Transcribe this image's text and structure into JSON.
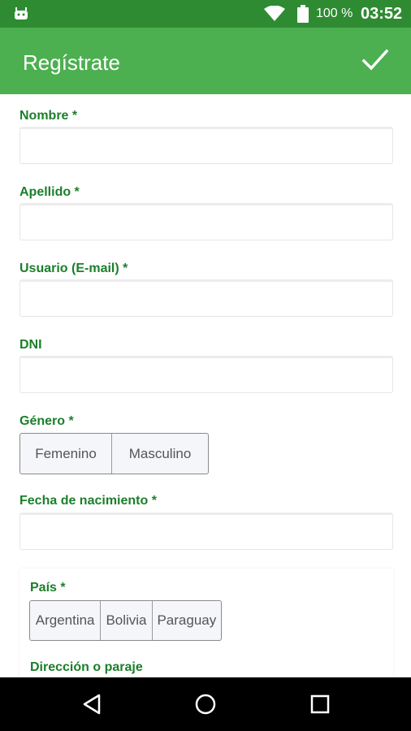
{
  "status_bar": {
    "battery_percent": "100 %",
    "time": "03:52",
    "icons": [
      "android-icon",
      "wifi-icon",
      "battery-icon"
    ]
  },
  "app_bar": {
    "title": "Regístrate",
    "confirm_icon": "check-icon"
  },
  "form": {
    "nombre_label": "Nombre *",
    "apellido_label": "Apellido *",
    "usuario_label": "Usuario (E-mail) *",
    "dni_label": "DNI",
    "genero_label": "Género *",
    "genero_options": [
      "Femenino",
      "Masculino"
    ],
    "fecha_label": "Fecha de nacimiento *",
    "pais_label": "País *",
    "pais_options": [
      "Argentina",
      "Bolivia",
      "Paraguay"
    ],
    "direccion_label": "Dirección o paraje"
  },
  "nav_bar": {
    "icons": [
      "back-icon",
      "home-icon",
      "recents-icon"
    ]
  },
  "colors": {
    "status_bar": "#2e8b32",
    "app_bar": "#4caf50",
    "label_green": "#1b7f2a"
  }
}
